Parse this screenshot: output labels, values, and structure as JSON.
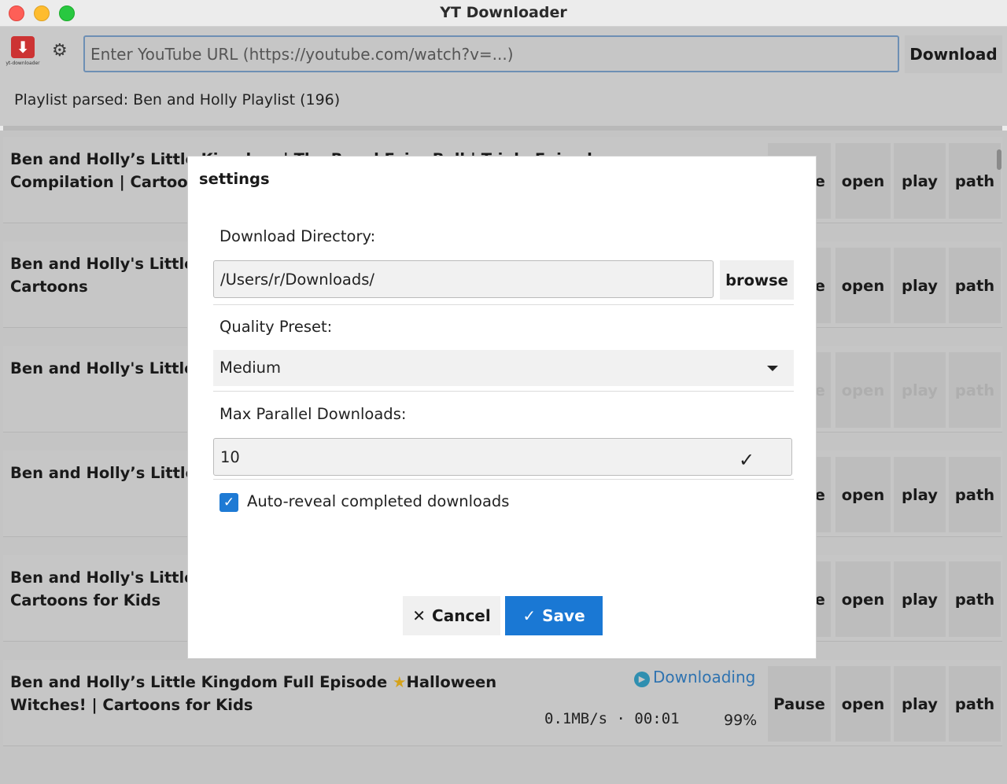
{
  "window": {
    "title": "YT Downloader"
  },
  "toolbar": {
    "logo_text": "yt-downloader",
    "url_placeholder": "Enter YouTube URL (https://youtube.com/watch?v=...)",
    "download_label": "Download"
  },
  "status": {
    "text": "Playlist parsed: Ben and Holly Playlist (196)"
  },
  "list": {
    "rows": [
      {
        "title": "Ben and Holly’s Little Kingdom | The Royal Fairy Ball | Triple Episode Compilation | Cartoons for Kids",
        "pause": "Pause",
        "open": "open",
        "play": "play",
        "path": "path"
      },
      {
        "title": "Ben and Holly's Little Kingdom | Full Episode | Kids Adventure Cartoons",
        "pause": "Pause",
        "open": "open",
        "play": "play",
        "path": "path"
      },
      {
        "title": "Ben and Holly's Little Kingdom | Full Episode | Adventure Cartoons",
        "pause": "Pause",
        "open": "open",
        "play": "play",
        "path": "path"
      },
      {
        "title": "Ben and Holly’s Little Kingdom | Full Episode | Cartoons",
        "pause": "Pause",
        "open": "open",
        "play": "play",
        "path": "path"
      },
      {
        "title": "Ben and Holly's Little Kingdom | Full Episode Compilation #14 | Cartoons for Kids",
        "pause": "Pause",
        "open": "open",
        "play": "play",
        "path": "path"
      },
      {
        "title_part1": "Ben and Holly’s Little Kingdom Full Episode ",
        "title_star": "★",
        "title_part2": "Halloween Witches! | Cartoons for Kids",
        "status": "Downloading",
        "speed": "0.1MB/s · 00:01",
        "percent": "99%",
        "pause": "Pause",
        "open": "open",
        "play": "play",
        "path": "path"
      }
    ]
  },
  "dialog": {
    "title": "settings",
    "download_dir_label": "Download Directory:",
    "download_dir_value": "/Users/r/Downloads/",
    "browse_label": "browse",
    "quality_label": "Quality Preset:",
    "quality_value": "Medium",
    "max_parallel_label": "Max Parallel Downloads:",
    "max_parallel_value": "10",
    "auto_reveal_label": "Auto-reveal completed downloads",
    "auto_reveal_checked": true,
    "cancel_label": "Cancel",
    "save_label": "Save"
  },
  "colors": {
    "accent": "#1a78d4",
    "downloading": "#2f73b0",
    "star": "#d5a21a"
  }
}
